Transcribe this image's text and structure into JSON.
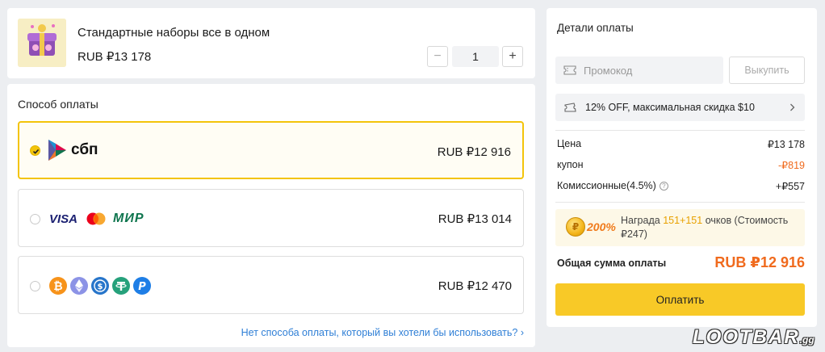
{
  "product": {
    "title": "Стандартные наборы все в одном",
    "price": "RUB ₽13 178",
    "qty_minus": "−",
    "qty_value": "1",
    "qty_plus": "+"
  },
  "payment": {
    "section_title": "Способ оплаты",
    "methods": [
      {
        "id": "sbp",
        "icon": "sbp-logo",
        "label": "сбп",
        "price": "RUB ₽12 916",
        "selected": true
      },
      {
        "id": "cards",
        "icons": [
          "visa-logo",
          "mastercard-logo",
          "mir-logo"
        ],
        "labels": [
          "VISA",
          "МИР"
        ],
        "price": "RUB ₽13 014",
        "selected": false
      },
      {
        "id": "crypto",
        "icons": [
          "bitcoin-icon",
          "ethereum-icon",
          "usdc-icon",
          "tether-icon",
          "paypal-icon"
        ],
        "price": "RUB ₽12 470",
        "selected": false
      }
    ],
    "no_method_link": "Нет способа оплаты, который вы хотели бы использовать? ›"
  },
  "details": {
    "title": "Детали оплаты",
    "promo_placeholder": "Промокод",
    "buy_button": "Выкупить",
    "coupon_text": "12% OFF, максимальная скидка $10",
    "lines": [
      {
        "label": "Цена",
        "value": "₽13 178"
      },
      {
        "label": "купон",
        "value": "-₽819"
      },
      {
        "label": "Комиссионные(4.5%)",
        "value": "+₽557"
      }
    ],
    "reward": {
      "percent": "200%",
      "text_prefix": "Награда",
      "points": "151+151",
      "text_suffix": "очков (Стоимость ₽247)"
    },
    "total_label": "Общая сумма оплаты",
    "total_value": "RUB ₽12 916",
    "pay_button": "Оплатить"
  },
  "watermark": {
    "brand": "LOOTBAR",
    "suffix": ".gg"
  },
  "colors": {
    "accent": "#f8c927",
    "discount": "#f06a1d",
    "link": "#2f7fd6"
  }
}
